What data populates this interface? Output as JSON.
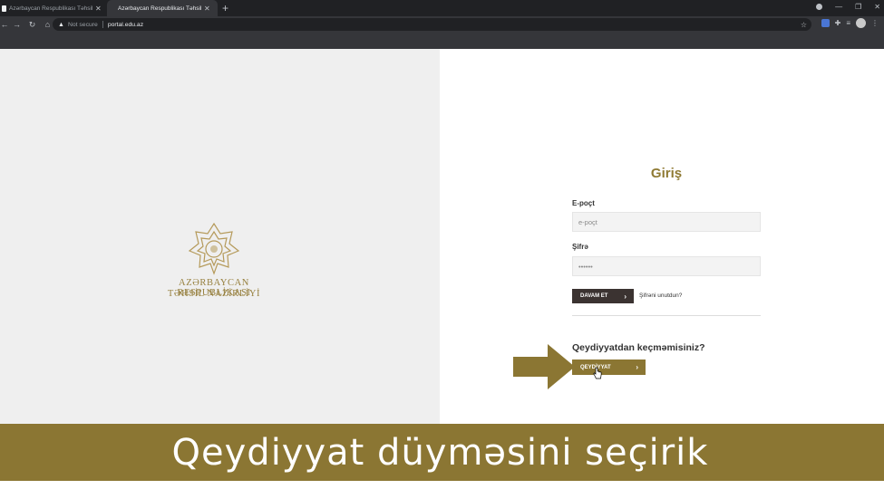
{
  "browser": {
    "tabs": [
      {
        "title": "Azərbaycan Respublikası Təhsil N"
      },
      {
        "title": "Azərbaycan Respublikası Təhsil N"
      }
    ],
    "security_label": "Not secure",
    "url": "portal.edu.az"
  },
  "brand": {
    "line1": "AZƏRBAYCAN RESPUBLİKASI",
    "line2": "TƏHSİL NAZİRLİYİ",
    "accent_color": "#8b7633"
  },
  "login": {
    "title": "Giriş",
    "email_label": "E-poçt",
    "email_placeholder": "e-poçt",
    "password_label": "Şifrə",
    "password_placeholder": "••••••",
    "continue_label": "DAVAM ET",
    "forgot_label": "Şifrəni unutdun?",
    "register_question": "Qeydiyyatdan keçməmisiniz?",
    "register_label": "QEYDİYYAT"
  },
  "caption": "Qeydiyyat düyməsini seçirik"
}
